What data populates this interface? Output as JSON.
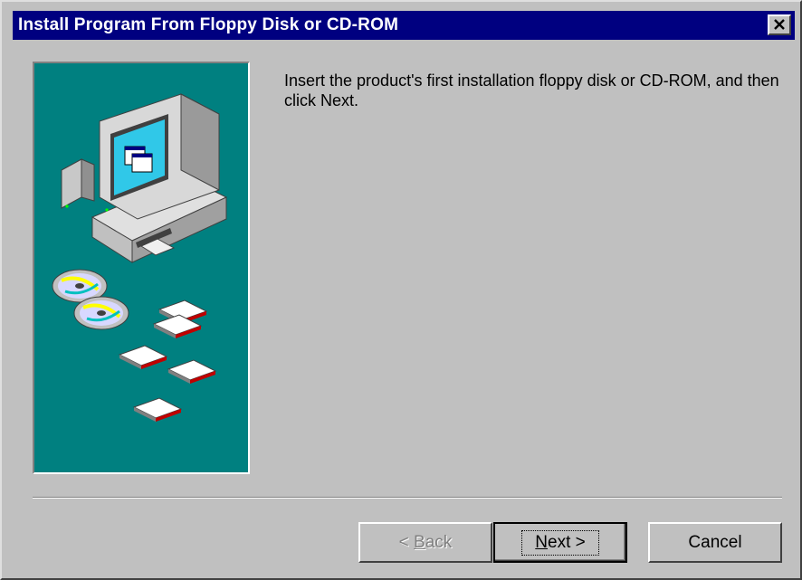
{
  "window": {
    "title": "Install Program From Floppy Disk or CD-ROM",
    "close_icon": "close-icon"
  },
  "content": {
    "instruction": "Insert the product's first installation floppy disk or CD-ROM, and then click Next.",
    "illustration_icons": [
      "computer-icon",
      "cd-rom-icon",
      "floppy-disk-icon"
    ]
  },
  "buttons": {
    "back": {
      "prefix": "< ",
      "mnemonic": "B",
      "rest": "ack",
      "enabled": false
    },
    "next": {
      "mnemonic": "N",
      "rest": "ext >",
      "default": true
    },
    "cancel": {
      "label": "Cancel"
    }
  },
  "colors": {
    "titlebar": "#000080",
    "dialog_face": "#c0c0c0",
    "art_background": "#008080"
  }
}
